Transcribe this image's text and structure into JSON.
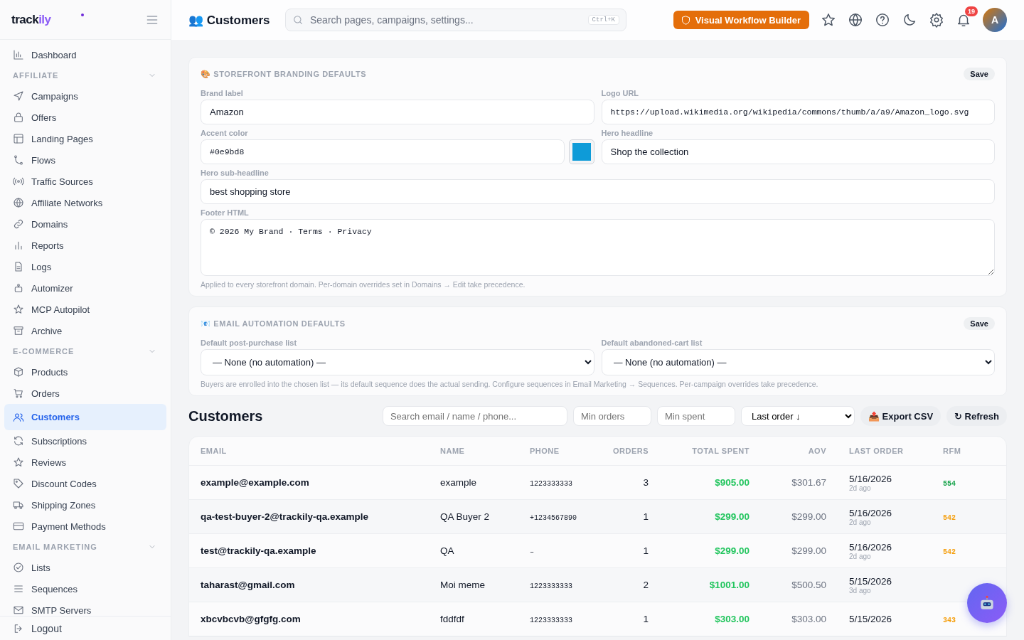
{
  "logo": {
    "text": "track",
    "accent": "ily"
  },
  "sidebar": {
    "top": [
      {
        "label": "Dashboard",
        "selected": false
      }
    ],
    "sections": [
      {
        "title": "AFFILIATE",
        "expanded": true,
        "items": [
          {
            "label": "Campaigns",
            "selected": false
          },
          {
            "label": "Offers",
            "selected": false
          },
          {
            "label": "Landing Pages",
            "selected": false
          },
          {
            "label": "Flows",
            "selected": false
          },
          {
            "label": "Traffic Sources",
            "selected": false
          },
          {
            "label": "Affiliate Networks",
            "selected": false
          },
          {
            "label": "Domains",
            "selected": false
          },
          {
            "label": "Reports",
            "selected": false
          },
          {
            "label": "Logs",
            "selected": false
          },
          {
            "label": "Automizer",
            "selected": false
          },
          {
            "label": "MCP Autopilot",
            "selected": false
          },
          {
            "label": "Archive",
            "selected": false
          }
        ]
      },
      {
        "title": "E-COMMERCE",
        "expanded": true,
        "items": [
          {
            "label": "Products",
            "selected": false
          },
          {
            "label": "Orders",
            "selected": false
          },
          {
            "label": "Customers",
            "selected": true
          },
          {
            "label": "Subscriptions",
            "selected": false
          },
          {
            "label": "Reviews",
            "selected": false
          },
          {
            "label": "Discount Codes",
            "selected": false
          },
          {
            "label": "Shipping Zones",
            "selected": false
          },
          {
            "label": "Payment Methods",
            "selected": false
          }
        ]
      },
      {
        "title": "EMAIL MARKETING",
        "expanded": true,
        "items": [
          {
            "label": "Lists",
            "selected": false
          },
          {
            "label": "Sequences",
            "selected": false
          },
          {
            "label": "SMTP Servers",
            "selected": false
          }
        ]
      }
    ],
    "logout": "Logout"
  },
  "header": {
    "title": "👥 Customers",
    "search": {
      "placeholder": "Search pages, campaigns, settings...",
      "shortcut": "Ctrl+K"
    },
    "workflow_button": "Visual Workflow Builder",
    "notifications": "19",
    "avatar": "A"
  },
  "branding": {
    "title": "🎨 STOREFRONT BRANDING DEFAULTS",
    "save": "Save",
    "brand_label": {
      "label": "Brand label",
      "value": "Amazon"
    },
    "logo_url": {
      "label": "Logo URL",
      "value": "https://upload.wikimedia.org/wikipedia/commons/thumb/a/a9/Amazon_logo.svg"
    },
    "accent": {
      "label": "Accent color",
      "value": "#0e9bd8",
      "color": "#0e9bd8"
    },
    "hero_headline": {
      "label": "Hero headline",
      "value": "Shop the collection"
    },
    "hero_sub": {
      "label": "Hero sub-headline",
      "value": "best shopping store"
    },
    "footer": {
      "label": "Footer HTML",
      "value": "© 2026 My Brand · Terms · Privacy"
    },
    "note": "Applied to every storefront domain. Per-domain overrides set in Domains → Edit take precedence."
  },
  "email": {
    "title": "📧 EMAIL AUTOMATION DEFAULTS",
    "save": "Save",
    "post_purchase": {
      "label": "Default post-purchase list",
      "value": "— None (no automation) —"
    },
    "abandoned": {
      "label": "Default abandoned-cart list",
      "value": "— None (no automation) —"
    },
    "note": "Buyers are enrolled into the chosen list — its default sequence does the actual sending. Configure sequences in Email Marketing → Sequences. Per-campaign overrides take precedence."
  },
  "customers": {
    "title": "Customers",
    "search": {
      "placeholder": "Search email / name / phone..."
    },
    "min_orders": {
      "placeholder": "Min orders"
    },
    "min_spent": {
      "placeholder": "Min spent"
    },
    "sort": "Last order ↓",
    "export": "📤 Export CSV",
    "refresh": "↻ Refresh",
    "table": {
      "columns": [
        "EMAIL",
        "NAME",
        "PHONE",
        "ORDERS",
        "TOTAL SPENT",
        "AOV",
        "LAST ORDER",
        "RFM"
      ],
      "rows": [
        {
          "email": "example@example.com",
          "name": "example",
          "phone": "1223333333",
          "orders": "3",
          "total": "$905.00",
          "aov": "$301.67",
          "date": "5/16/2026",
          "ago": "2d ago",
          "rfm": "554",
          "color": "#16a34a"
        },
        {
          "email": "qa-test-buyer-2@trackily-qa.example",
          "name": "QA Buyer 2",
          "phone": "+1234567890",
          "orders": "1",
          "total": "$299.00",
          "aov": "$299.00",
          "date": "5/16/2026",
          "ago": "2d ago",
          "rfm": "542",
          "color": "#f59e0b"
        },
        {
          "email": "test@trackily-qa.example",
          "name": "QA",
          "phone": "–",
          "orders": "1",
          "total": "$299.00",
          "aov": "$299.00",
          "date": "5/16/2026",
          "ago": "2d ago",
          "rfm": "542",
          "color": "#f59e0b"
        },
        {
          "email": "taharast@gmail.com",
          "name": "Moi meme",
          "phone": "1223333333",
          "orders": "2",
          "total": "$1001.00",
          "aov": "$500.50",
          "date": "5/15/2026",
          "ago": "3d ago"
        },
        {
          "email": "xbcvbcvb@gfgfg.com",
          "name": "fddfdf",
          "phone": "1223333333",
          "orders": "1",
          "total": "$303.00",
          "aov": "$303.00",
          "date": "5/15/2026",
          "rfm": "343",
          "color": "#f59e0b"
        }
      ]
    }
  }
}
